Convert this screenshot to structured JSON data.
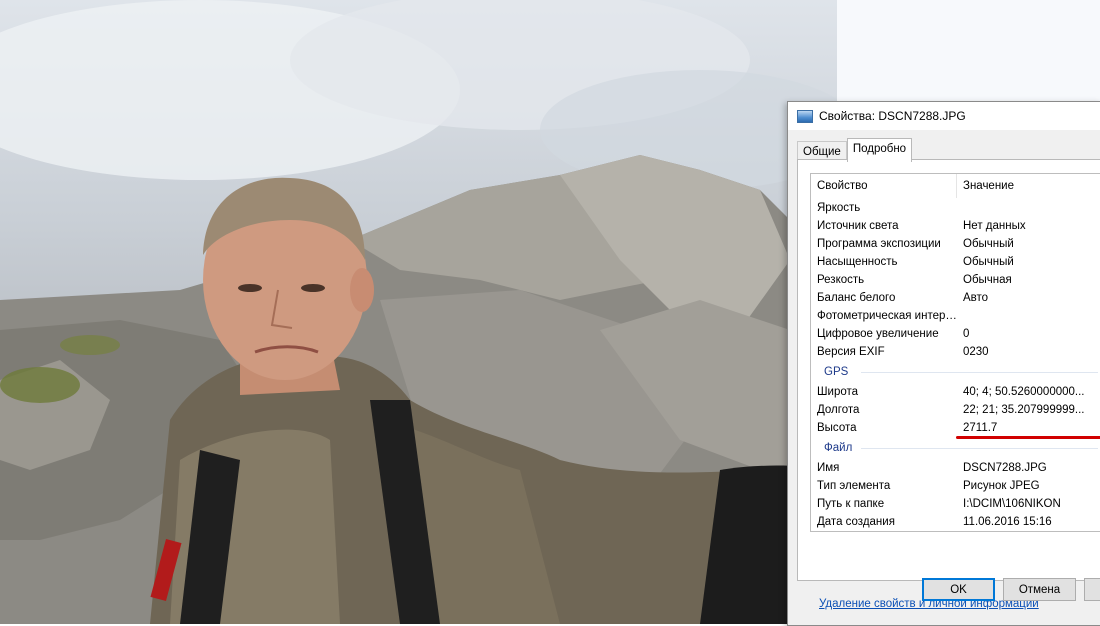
{
  "dialog": {
    "title": "Свойства: DSCN7288.JPG",
    "tabs": [
      {
        "label": "Общие",
        "active": false
      },
      {
        "label": "Подробно",
        "active": true
      }
    ],
    "columns": {
      "property": "Свойство",
      "value": "Значение"
    },
    "rows_top": [
      {
        "name": "Яркость",
        "value": ""
      },
      {
        "name": "Источник света",
        "value": "Нет данных"
      },
      {
        "name": "Программа экспозиции",
        "value": "Обычный"
      },
      {
        "name": "Насыщенность",
        "value": "Обычный"
      },
      {
        "name": "Резкость",
        "value": "Обычная"
      },
      {
        "name": "Баланс белого",
        "value": "Авто"
      },
      {
        "name": "Фотометрическая интер…",
        "value": ""
      },
      {
        "name": "Цифровое увеличение",
        "value": "0"
      },
      {
        "name": "Версия EXIF",
        "value": "0230"
      }
    ],
    "group_gps": "GPS",
    "rows_gps": [
      {
        "name": "Широта",
        "value": "40; 4; 50.5260000000..."
      },
      {
        "name": "Долгота",
        "value": "22; 21; 35.207999999..."
      },
      {
        "name": "Высота",
        "value": "2711.7"
      }
    ],
    "group_file": "Файл",
    "rows_file": [
      {
        "name": "Имя",
        "value": "DSCN7288.JPG"
      },
      {
        "name": "Тип элемента",
        "value": "Рисунок JPEG"
      },
      {
        "name": "Путь к папке",
        "value": "I:\\DCIM\\106NIKON"
      },
      {
        "name": "Дата создания",
        "value": "11.06.2016 15:16"
      }
    ],
    "remove_link": "Удаление свойств и личной информации",
    "buttons": {
      "ok": "OK",
      "cancel": "Отмена"
    }
  },
  "colors": {
    "accent": "#0078d7",
    "group_header": "#1e3a8a",
    "highlight_underline": "#d10000",
    "link": "#0a4fb5"
  }
}
